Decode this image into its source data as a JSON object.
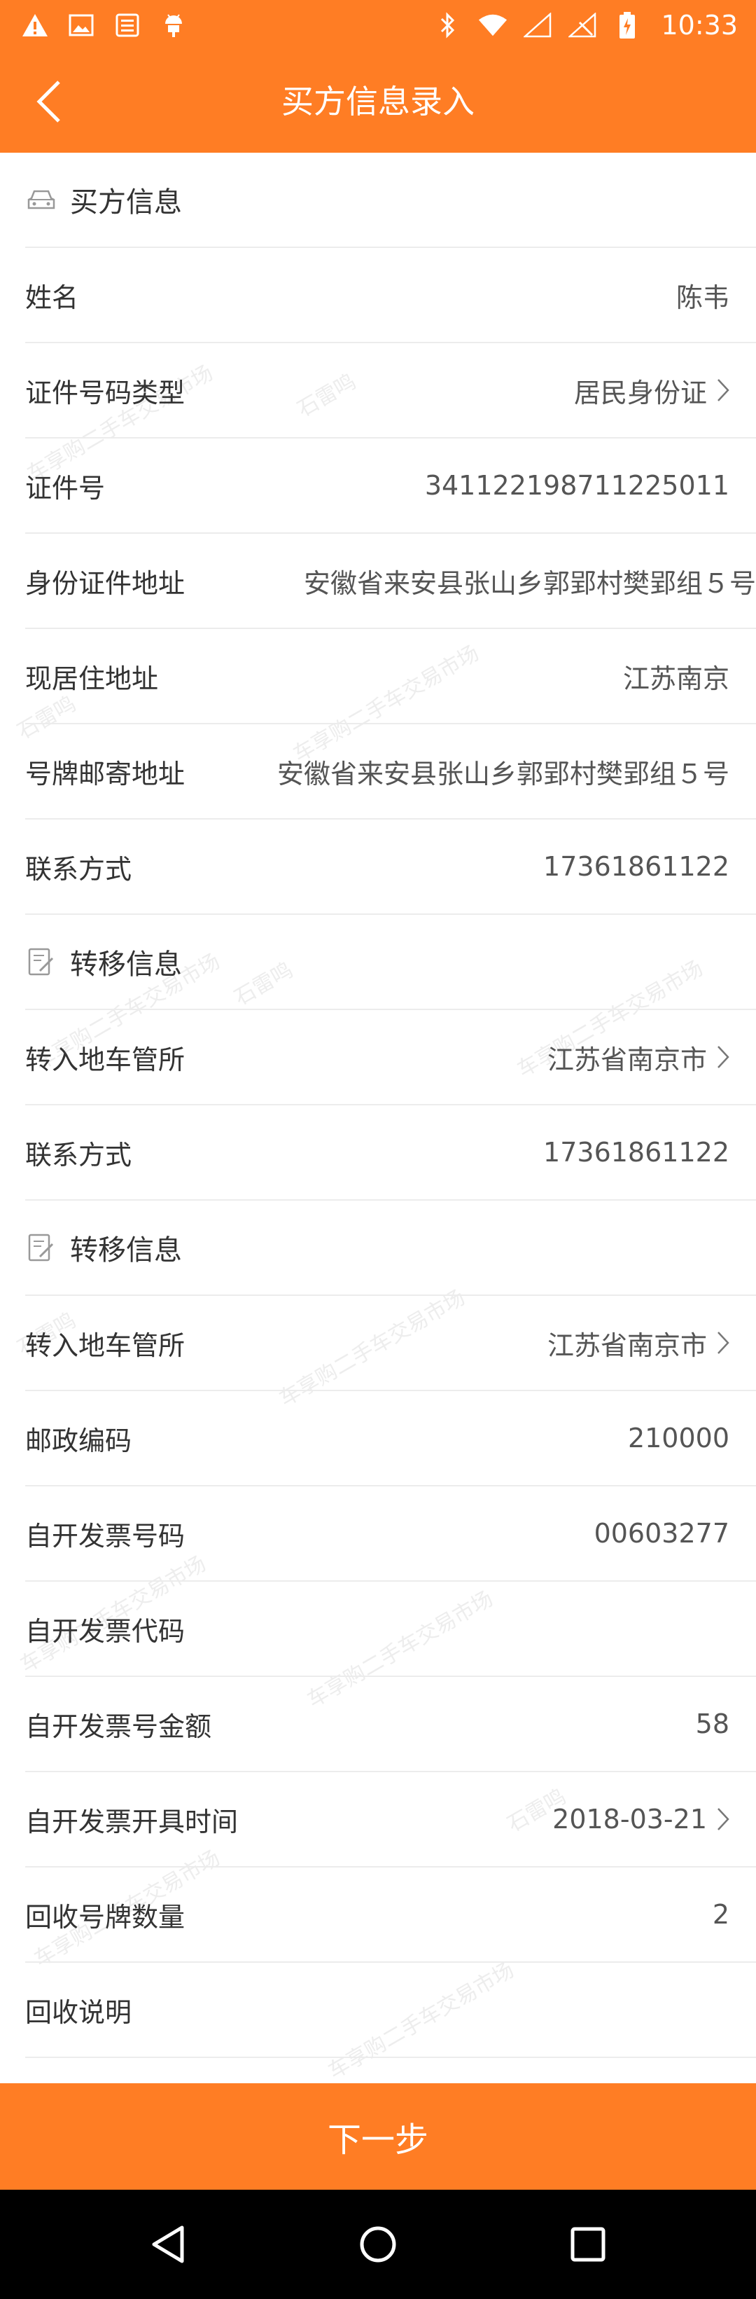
{
  "status_bar": {
    "time": "10:33",
    "icons_left": [
      "warning-icon",
      "image-icon",
      "storage-icon",
      "android-icon"
    ],
    "icons_right": [
      "bluetooth-icon",
      "wifi-icon",
      "signal-icon",
      "no-sim-icon",
      "battery-charging-icon"
    ]
  },
  "app_bar": {
    "title": "买方信息录入",
    "back_icon": "chevron-left-icon"
  },
  "sections": {
    "buyer": {
      "title": "买方信息",
      "icon": "car-icon"
    },
    "transfer1": {
      "title": "转移信息",
      "icon": "edit-note-icon"
    },
    "transfer2": {
      "title": "转移信息",
      "icon": "edit-note-icon"
    }
  },
  "fields": {
    "name": {
      "label": "姓名",
      "value": "陈韦"
    },
    "id_type": {
      "label": "证件号码类型",
      "value": "居民身份证"
    },
    "id_number": {
      "label": "证件号",
      "value": "341122198711225011"
    },
    "id_address": {
      "label": "身份证件地址",
      "value": "安徽省来安县张山乡郭郢村樊郢组５号"
    },
    "current_address": {
      "label": "现居住地址",
      "value": "江苏南京"
    },
    "plate_mail_address": {
      "label": "号牌邮寄地址",
      "value": "安徽省来安县张山乡郭郢村樊郢组５号"
    },
    "contact1": {
      "label": "联系方式",
      "value": "17361861122"
    },
    "dmv1": {
      "label": "转入地车管所",
      "value": "江苏省南京市"
    },
    "contact2": {
      "label": "联系方式",
      "value": "17361861122"
    },
    "dmv2": {
      "label": "转入地车管所",
      "value": "江苏省南京市"
    },
    "postal_code": {
      "label": "邮政编码",
      "value": "210000"
    },
    "invoice_number": {
      "label": "自开发票号码",
      "value": "00603277"
    },
    "invoice_code": {
      "label": "自开发票代码",
      "value": ""
    },
    "invoice_amount": {
      "label": "自开发票号金额",
      "value": "58"
    },
    "invoice_date": {
      "label": "自开发票开具时间",
      "value": "2018-03-21"
    },
    "plate_count": {
      "label": "回收号牌数量",
      "value": "2"
    },
    "recycle_note": {
      "label": "回收说明",
      "value": ""
    }
  },
  "watermark": {
    "text1": "车享购二手车交易市场",
    "text2": "石雷鸣"
  },
  "next_button": "下一步",
  "colors": {
    "accent": "#ff7d24",
    "nav": "#000000",
    "divider": "#ececec"
  }
}
